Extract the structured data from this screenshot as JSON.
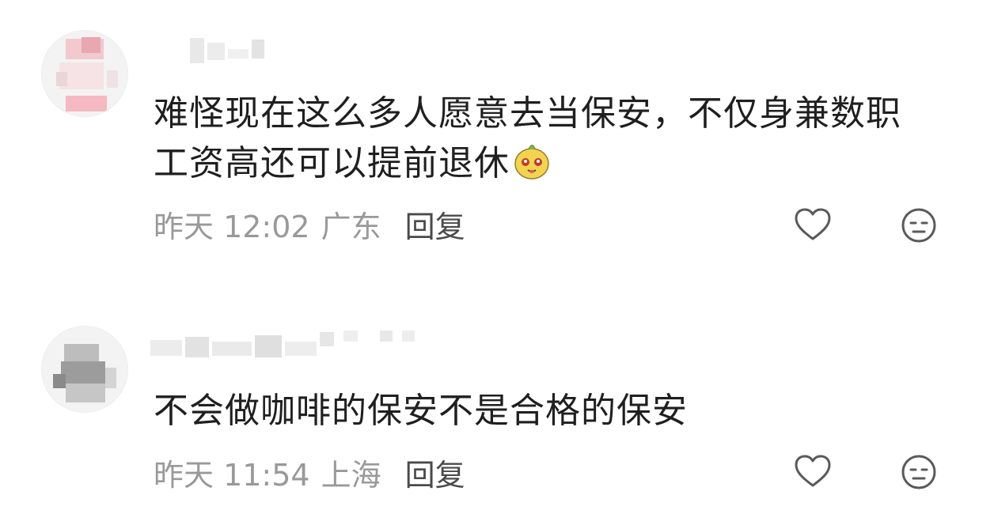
{
  "comments": [
    {
      "text": "难怪现在这么多人愿意去当保安，不仅身兼数职\n工资高还可以提前退休",
      "emoji": "potato-face-emoji",
      "time": "昨天 12:02",
      "location": "广东",
      "reply_label": "回复"
    },
    {
      "text": "不会做咖啡的保安不是合格的保安",
      "time": "昨天 11:54",
      "location": "上海",
      "reply_label": "回复"
    }
  ],
  "colors": {
    "text": "#1f1f1f",
    "meta": "#999999",
    "reply": "#4a4a4a",
    "icon": "#5a5a5a"
  },
  "icons": {
    "like": "heart-outline-icon",
    "dislike": "neutral-face-icon"
  }
}
